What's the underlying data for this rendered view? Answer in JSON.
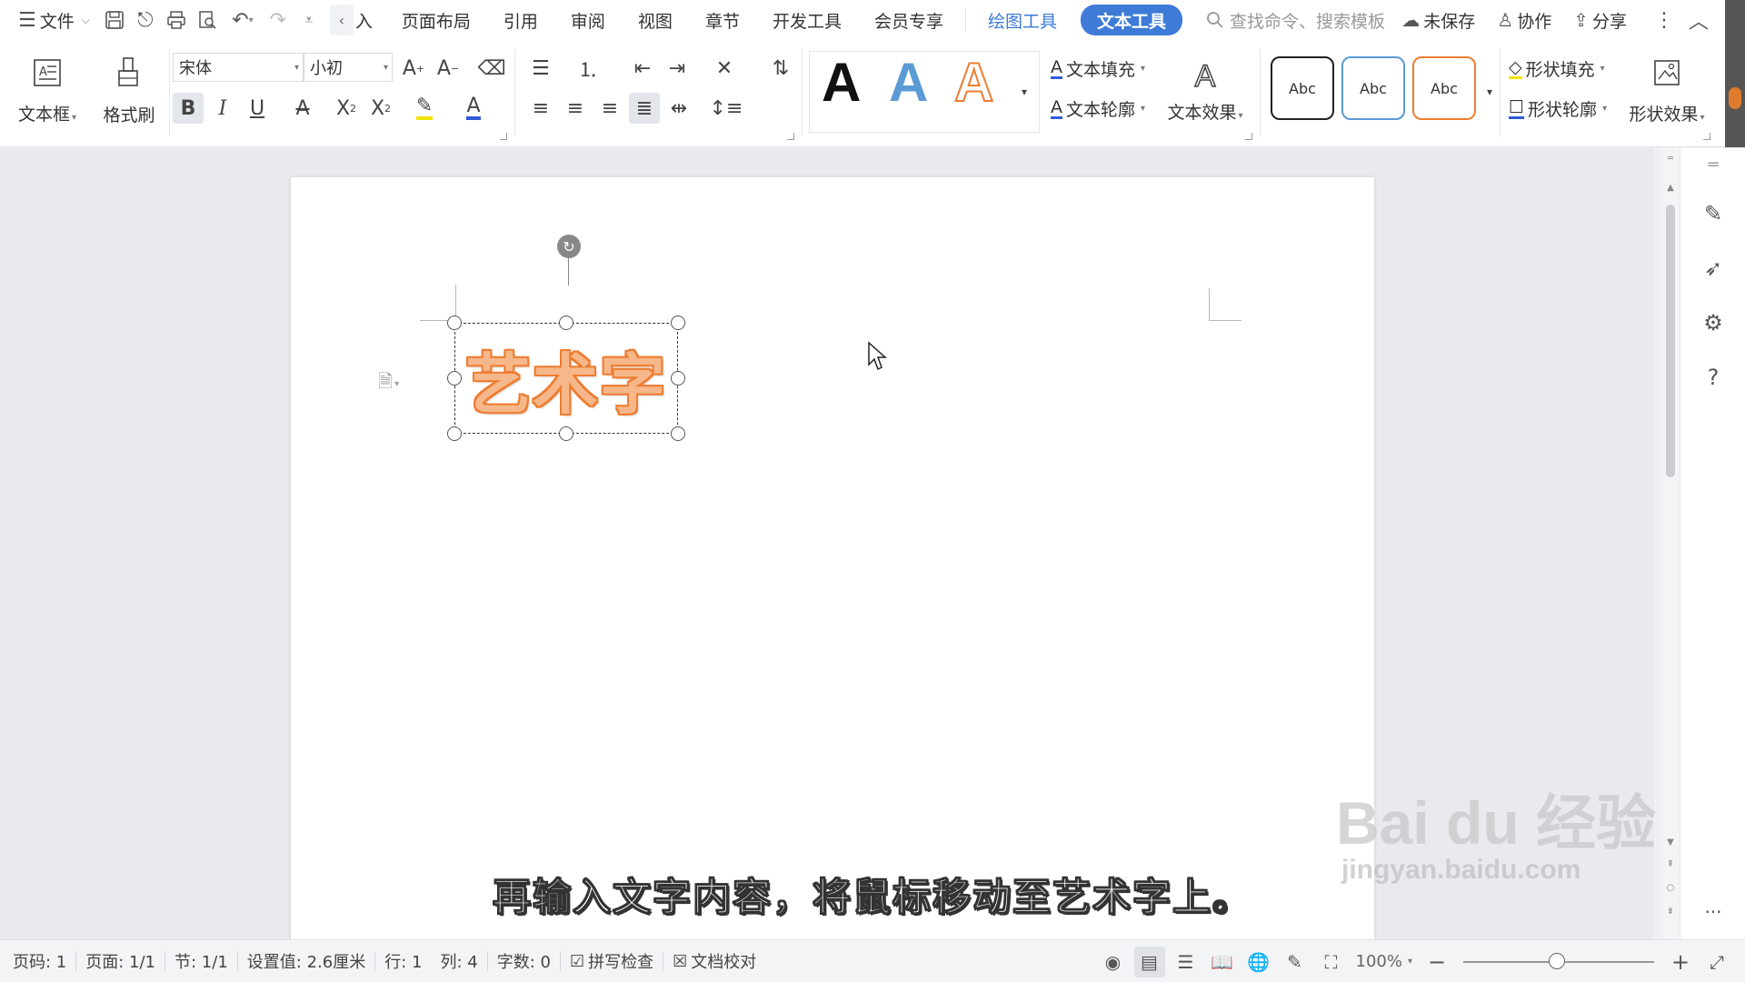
{
  "menubar": {
    "file_label": "文件",
    "tab_partial": "入",
    "tabs": [
      "页面布局",
      "引用",
      "审阅",
      "视图",
      "章节",
      "开发工具",
      "会员专享"
    ],
    "context_tab": "绘图工具",
    "active_tab": "文本工具",
    "search_placeholder": "查找命令、搜索模板",
    "unsaved_label": "未保存",
    "collab_label": "协作",
    "share_label": "分享"
  },
  "ribbon": {
    "textbox_label": "文本框",
    "format_painter_label": "格式刷",
    "font_name": "宋体",
    "font_size": "小初",
    "bold_glyph": "B",
    "italic_glyph": "I",
    "underline_glyph": "U",
    "style_letter": "A",
    "text_fill_label": "文本填充",
    "text_outline_label": "文本轮廓",
    "text_effect_label": "文本效果",
    "shape_styles": [
      "Abc",
      "Abc",
      "Abc"
    ],
    "shape_fill_label": "形状填充",
    "shape_outline_label": "形状轮廓",
    "shape_effect_label": "形状效果"
  },
  "document": {
    "art_text": "艺术字",
    "subtitle": "再输入文字内容，将鼠标移动至艺术字上。"
  },
  "watermark": {
    "brand": "Bai du 经验",
    "url": "jingyan.baidu.com"
  },
  "statusbar": {
    "page_num": "页码: 1",
    "pages": "页面: 1/1",
    "section": "节: 1/1",
    "setting": "设置值: 2.6厘米",
    "row": "行: 1",
    "col": "列: 4",
    "word_count": "字数: 0",
    "spell_check": "拼写检查",
    "doc_proof": "文档校对",
    "zoom": "100%"
  },
  "colors": {
    "accent": "#3d7bd6",
    "art_orange": "#ed7d31",
    "style_blue": "#5b9bd5"
  },
  "zoom_level": 100
}
